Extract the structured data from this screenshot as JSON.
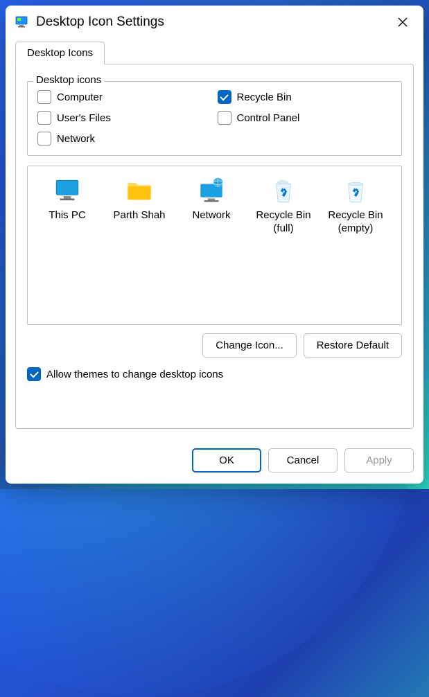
{
  "titlebar": {
    "title": "Desktop Icon Settings"
  },
  "tabs": {
    "active": "Desktop Icons"
  },
  "fieldset": {
    "legend": "Desktop icons",
    "items": [
      {
        "label": "Computer",
        "checked": false
      },
      {
        "label": "Recycle Bin",
        "checked": true
      },
      {
        "label": "User's Files",
        "checked": false
      },
      {
        "label": "Control Panel",
        "checked": false
      },
      {
        "label": "Network",
        "checked": false
      }
    ]
  },
  "icons": [
    {
      "label": "This PC",
      "icon": "monitor-icon"
    },
    {
      "label": "Parth Shah",
      "icon": "folder-icon"
    },
    {
      "label": "Network",
      "icon": "network-icon"
    },
    {
      "label": "Recycle Bin (full)",
      "icon": "recycle-full-icon"
    },
    {
      "label": "Recycle Bin (empty)",
      "icon": "recycle-empty-icon"
    }
  ],
  "buttons": {
    "change_icon": "Change Icon...",
    "restore_default": "Restore Default",
    "ok": "OK",
    "cancel": "Cancel",
    "apply": "Apply"
  },
  "allow_themes": {
    "label": "Allow themes to change desktop icons",
    "checked": true
  },
  "colors": {
    "accent": "#0067c0"
  }
}
